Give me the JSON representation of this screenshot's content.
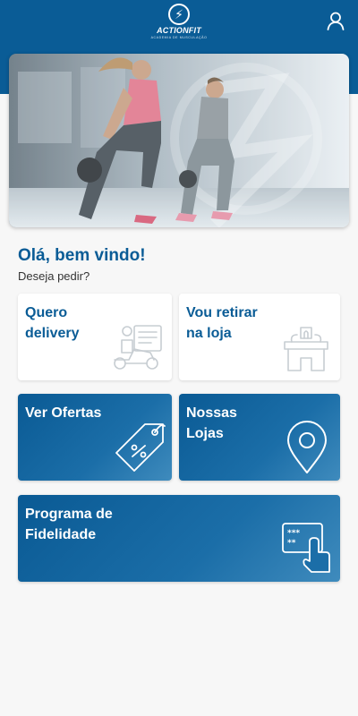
{
  "header": {
    "logo_text": "ACTIONFIT",
    "logo_subtext": "ACADEMIA DE MUSCULAÇÃO",
    "logo_mark": "⚡",
    "profile_icon": "user-icon",
    "background_color": "#0a5c96"
  },
  "hero": {
    "icon": "fitness-photo"
  },
  "welcome": {
    "title": "Olá, bem vindo!",
    "subtitle": "Deseja pedir?"
  },
  "options": [
    {
      "label": "Quero\ndelivery",
      "icon": "delivery-scooter-icon"
    },
    {
      "label": "Vou retirar\nna loja",
      "icon": "store-pickup-icon"
    },
    {
      "label": "Ver Ofertas",
      "icon": "discount-tag-icon"
    },
    {
      "label": "Nossas\nLojas",
      "icon": "location-pin-icon"
    },
    {
      "label": "Programa de\nFidelidade",
      "icon": "loyalty-card-icon"
    }
  ],
  "colors": {
    "primary": "#0a5c96",
    "card_light": "#ffffff",
    "background": "#f7f7f7"
  }
}
